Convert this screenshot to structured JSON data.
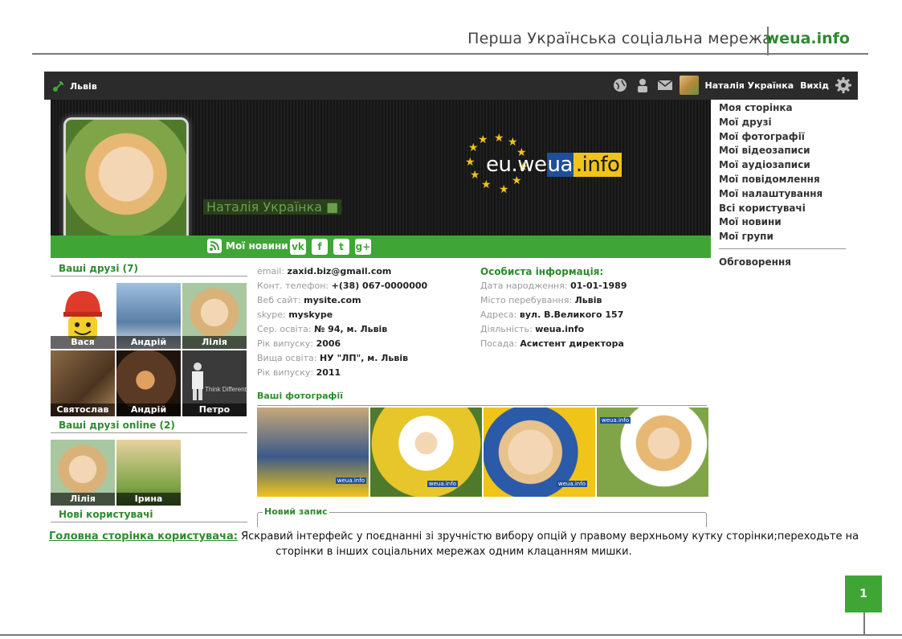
{
  "slide": {
    "title": "Перша Українська соціальна мережа",
    "brand": "weua.info",
    "page_number": "1"
  },
  "topbar": {
    "city": "Львів",
    "user_name": "Наталія Українка",
    "logout": "Вихід"
  },
  "cover": {
    "name": "Наталія Українка ■",
    "logo_prefix": "eu.we",
    "logo_box": "ua",
    "logo_suffix": ".info",
    "news_label": "Мої новини"
  },
  "social": [
    "vk",
    "f",
    "t",
    "g+"
  ],
  "menu": {
    "items": [
      "Моя сторінка",
      "Мої друзі",
      "Мої фотографії",
      "Мої відеозаписи",
      "Мої аудіозаписи",
      "Мої повідомлення",
      "Мої налаштування",
      "Всі користувачі",
      "Мої новини",
      "Мої групи"
    ],
    "discussions": "Обговорення"
  },
  "friends": {
    "title": "Ваші друзі (7)",
    "items": [
      {
        "name": "Вася",
        "color": "#e8c23a"
      },
      {
        "name": "Андрій",
        "color": "#6b8fb5"
      },
      {
        "name": "Лілія",
        "color": "#d9b27a"
      },
      {
        "name": "Святослав",
        "color": "#7a5a3a"
      },
      {
        "name": "Андрій",
        "color": "#5a3a24"
      },
      {
        "name": "Петро",
        "color": "#3a3a3a"
      }
    ],
    "think_different": "Think Different"
  },
  "online": {
    "title": "Ваші друзі online (2)",
    "items": [
      {
        "name": "Лілія",
        "color": "#d9b27a"
      },
      {
        "name": "Ірина",
        "color": "#7fa548"
      }
    ]
  },
  "new_users": "Нові користувачі",
  "contacts": [
    {
      "key": "email:",
      "val": "zaxid.biz@gmail.com"
    },
    {
      "key": "Конт. телефон:",
      "val": "+(38) 067-0000000"
    },
    {
      "key": "Веб сайт:",
      "val": "mysite.com"
    },
    {
      "key": "skype:",
      "val": "myskype"
    },
    {
      "key": "Сер. освіта:",
      "val": "№ 94, м. Львів"
    },
    {
      "key": "Рік випуску:",
      "val": "2006"
    },
    {
      "key": "Вища освіта:",
      "val": "НУ \"ЛП\", м. Львів"
    },
    {
      "key": "Рік випуску:",
      "val": "2011"
    }
  ],
  "personal": {
    "title": "Особиста інформація:",
    "rows": [
      {
        "key": "Дата народження:",
        "val": "01-01-1989"
      },
      {
        "key": "Місто перебування:",
        "val": "Львів"
      },
      {
        "key": "Адреса:",
        "val": "вул. В.Великого 157"
      },
      {
        "key": "Діяльність:",
        "val": "weua.info"
      },
      {
        "key": "Посада:",
        "val": "Асистент директора"
      }
    ]
  },
  "photos": {
    "title": "Ваші фотографії",
    "colors": [
      "#3b5a8a",
      "#e6c62a",
      "#5a7fbf",
      "#7fa548"
    ],
    "watermark": "weua.info"
  },
  "new_entry": "Новий запис",
  "caption": {
    "link": "Головна сторінка користувача:",
    "text": " Яскравий інтерфейс у поєднанні зі зручністю вибору опцій у правому верхньому кутку сторінки;переходьте  на сторінки в інших соціальних мережах одним клацанням мишки."
  }
}
